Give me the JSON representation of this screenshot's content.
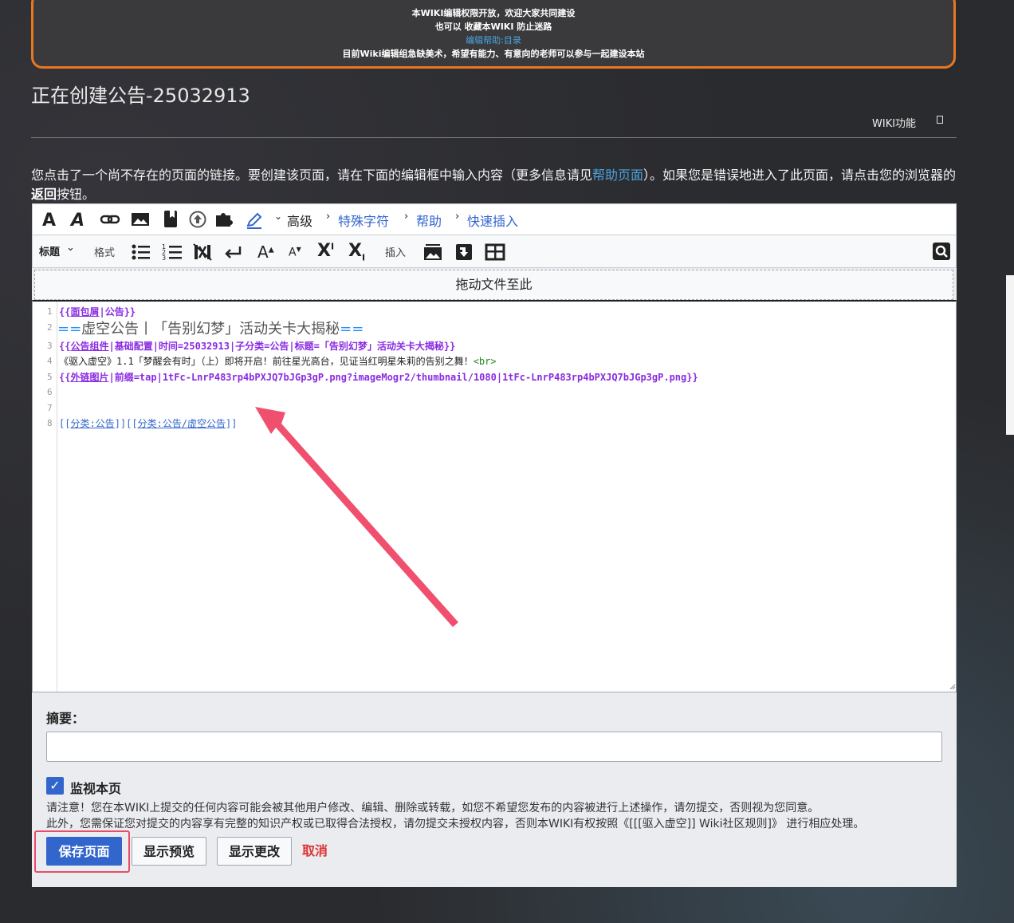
{
  "notice": {
    "line1": "本WIKI编辑权限开放，欢迎大家共同建设",
    "line2": "也可以 收藏本WIKI 防止迷路",
    "help_link": "编辑帮助:目录",
    "line4": "目前Wiki编辑组急缺美术，希望有能力、有意向的老师可以参与一起建设本站"
  },
  "page_title": "正在创建公告-25032913",
  "wiki_func_label": "WIKI功能",
  "intro": {
    "part1": "您点击了一个尚不存在的页面的链接。要创建该页面，请在下面的编辑框中输入内容（更多信息请见",
    "help_link": "帮助页面",
    "part2": "）。如果您是错误地进入了此页面，请点击您的浏览器的",
    "back": "返回",
    "part3": "按钮。"
  },
  "toolbar": {
    "advanced": "高级",
    "special_chars": "特殊字符",
    "help": "帮助",
    "quick_insert": "快速插入",
    "heading": "标题",
    "format": "格式",
    "insert": "插入"
  },
  "dropzone_label": "拖动文件至此",
  "code_lines": {
    "l1": [
      "1",
      "{{",
      "面包屑",
      "|公告}}"
    ],
    "l2": [
      "2",
      "==",
      "虚空公告丨「告别幻梦」活动关卡大揭秘",
      "=="
    ],
    "l3": [
      "3",
      "{{",
      "公告组件",
      "|基础配置|时间=25032913|子分类=公告|标题=「告别幻梦」活动关卡大揭秘}}"
    ],
    "l4": [
      "4",
      "《驱入虚空》1.1「梦醒会有时」（上）即将开启！前往星光高台，见证当红明星朱莉的告别之舞！",
      "<br>"
    ],
    "l5": [
      "5",
      "{{",
      "外链图片",
      "|前缀=tap|1tFc-LnrP483rp4bPXJQ7bJGp3gP.png?imageMogr2/thumbnail/1080|1tFc-LnrP483rp4bPXJQ7bJGp3gP.png}}"
    ],
    "l6": "6",
    "l7": "7",
    "l8": [
      "8",
      "[[",
      "分类:公告",
      "]]",
      "[[",
      "分类:公告/虚空公告",
      "]]"
    ]
  },
  "summary_label": "摘要：",
  "watch_label": "监视本页",
  "copyright1": "请注意！您在本WIKI上提交的任何内容可能会被其他用户修改、编辑、删除或转载，如您不希望您发布的内容被进行上述操作，请勿提交，否则视为您同意。",
  "copyright2": "此外，您需保证您对提交的内容享有完整的知识产权或已取得合法授权，请勿提交未授权内容，否则本WIKI有权按照《[[[驱入虚空]] Wiki社区规则]》 进行相应处理。",
  "buttons": {
    "save": "保存页面",
    "preview": "显示预览",
    "diff": "显示更改",
    "cancel": "取消"
  },
  "colors": {
    "accent": "#3366cc",
    "notice_border": "#e87722",
    "highlight": "#e84c6a",
    "arrow": "#f0506e"
  }
}
